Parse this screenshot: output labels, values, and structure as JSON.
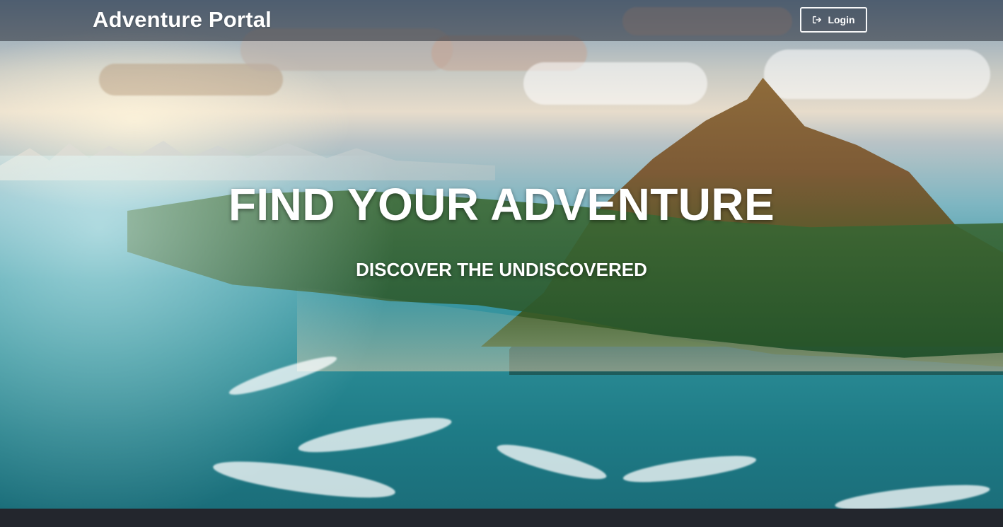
{
  "header": {
    "brand": "Adventure Portal",
    "login_label": "Login",
    "login_icon": "sign-in-icon"
  },
  "hero": {
    "title": "FIND YOUR ADVENTURE",
    "subtitle": "DISCOVER THE UNDISCOVERED"
  },
  "colors": {
    "header_overlay": "#282C34",
    "footer": "#23262D",
    "text": "#FFFFFF"
  }
}
